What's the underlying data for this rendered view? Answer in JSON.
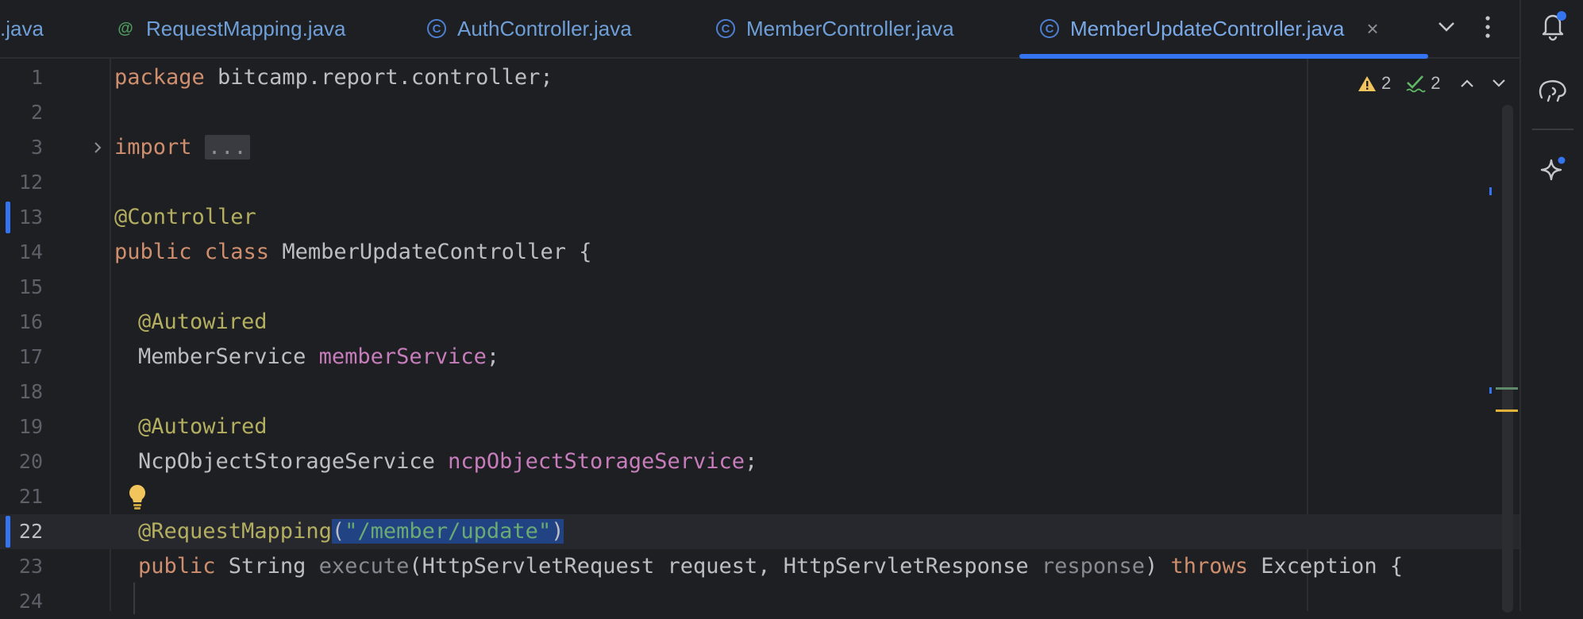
{
  "tabs": [
    {
      "label": ".java",
      "icon": "class-icon"
    },
    {
      "label": "RequestMapping.java",
      "icon": "annotation-icon"
    },
    {
      "label": "AuthController.java",
      "icon": "class-icon"
    },
    {
      "label": "MemberController.java",
      "icon": "class-icon"
    },
    {
      "label": "MemberUpdateController.java",
      "icon": "class-icon",
      "active": true
    }
  ],
  "inspections": {
    "warnings": "2",
    "weak_warnings": "2"
  },
  "lines": [
    {
      "num": "1"
    },
    {
      "num": "2"
    },
    {
      "num": "3"
    },
    {
      "num": "12"
    },
    {
      "num": "13"
    },
    {
      "num": "14"
    },
    {
      "num": "15"
    },
    {
      "num": "16"
    },
    {
      "num": "17"
    },
    {
      "num": "18"
    },
    {
      "num": "19"
    },
    {
      "num": "20"
    },
    {
      "num": "21"
    },
    {
      "num": "22"
    },
    {
      "num": "23"
    },
    {
      "num": "24"
    }
  ],
  "code": {
    "l1_kw": "package",
    "l1_rest": " bitcamp.report.controller;",
    "l3_kw": "import",
    "l3_fold": "...",
    "l13_an": "@Controller",
    "l14_kw": "public class",
    "l14_rest": " MemberUpdateController {",
    "l16_an": "@Autowired",
    "l17_type": "MemberService ",
    "l17_field": "memberService",
    "l17_end": ";",
    "l19_an": "@Autowired",
    "l20_type": "NcpObjectStorageService ",
    "l20_field": "ncpObjectStorageService",
    "l20_end": ";",
    "l22_an": "@RequestMapping",
    "l22_open": "(",
    "l22_str": "\"/member/update\"",
    "l22_close": ")",
    "l23_kw1": "public",
    "l23_a": " String ",
    "l23_method": "execute",
    "l23_b": "(HttpServletRequest request, HttpServletResponse ",
    "l23_param": "response",
    "l23_c": ") ",
    "l23_kw2": "throws",
    "l23_d": " Exception {"
  },
  "colors": {
    "keyword": "#cf8e6d",
    "annotation": "#b3ae60",
    "field": "#c77dbb",
    "string": "#6aab73",
    "accent": "#3574f0",
    "background": "#1e1f22"
  }
}
